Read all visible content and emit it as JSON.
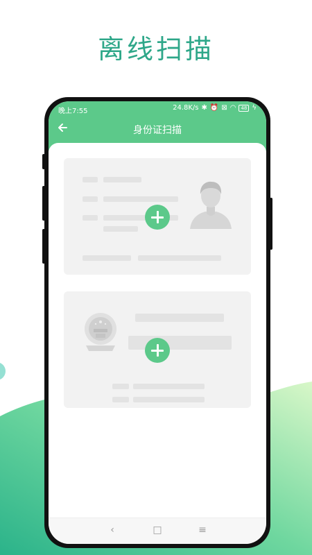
{
  "headline": "离线扫描",
  "status_bar": {
    "time": "晚上7:55",
    "speed": "24.8K/s",
    "battery": "48"
  },
  "app_bar": {
    "title": "身份证扫描",
    "back_icon": "arrow-left-icon"
  },
  "cards": [
    {
      "name": "id-front-card",
      "add_icon": "plus-icon",
      "portrait_icon": "person-avatar-icon"
    },
    {
      "name": "id-back-card",
      "add_icon": "plus-icon",
      "emblem_icon": "national-emblem-icon"
    }
  ],
  "nav": {
    "back": "‹",
    "home": "□",
    "menu": "≡"
  },
  "colors": {
    "accent": "#5cc98a",
    "headline": "#2ea789",
    "card_bg": "#f2f2f2"
  }
}
